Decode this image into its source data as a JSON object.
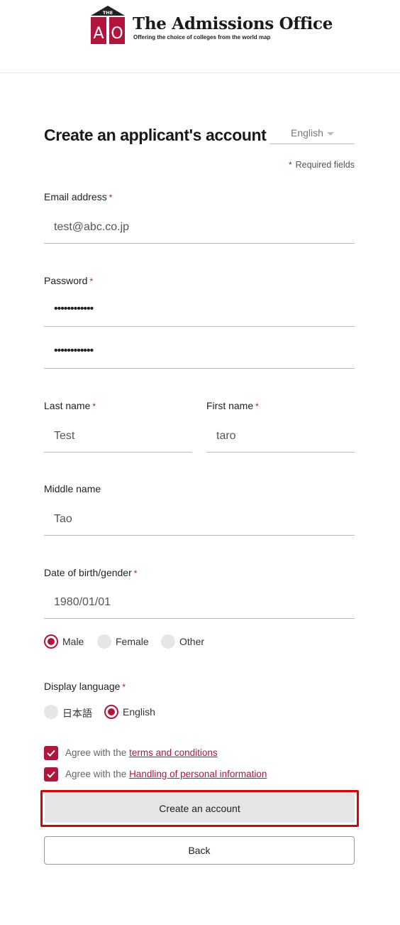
{
  "brand": {
    "logo_top": "THE",
    "logo_letters": "AO",
    "title": "The Admissions Office",
    "subtitle": "Offering the choice of colleges from the world map",
    "color": "#b3143d"
  },
  "form": {
    "title": "Create an applicant's account",
    "language_select": "English",
    "required_note": "Required fields",
    "required_mark": "*",
    "email": {
      "label": "Email address",
      "value": "test@abc.co.jp"
    },
    "password": {
      "label": "Password",
      "value": "••••••••••••",
      "confirm_value": "••••••••••••"
    },
    "last_name": {
      "label": "Last name",
      "value": "Test"
    },
    "first_name": {
      "label": "First name",
      "value": "taro"
    },
    "middle_name": {
      "label": "Middle name",
      "value": "Tao"
    },
    "birth_gender": {
      "label": "Date of birth/gender",
      "value": "1980/01/01",
      "options": [
        "Male",
        "Female",
        "Other"
      ],
      "selected": "Male"
    },
    "display_language": {
      "label": "Display language",
      "options": [
        "日本語",
        "English"
      ],
      "selected": "English"
    },
    "agreements": [
      {
        "prefix": "Agree with the ",
        "link": "terms and conditions",
        "checked": true
      },
      {
        "prefix": "Agree with the ",
        "link": "Handling of personal information",
        "checked": true
      }
    ],
    "submit_label": "Create an account",
    "back_label": "Back"
  }
}
